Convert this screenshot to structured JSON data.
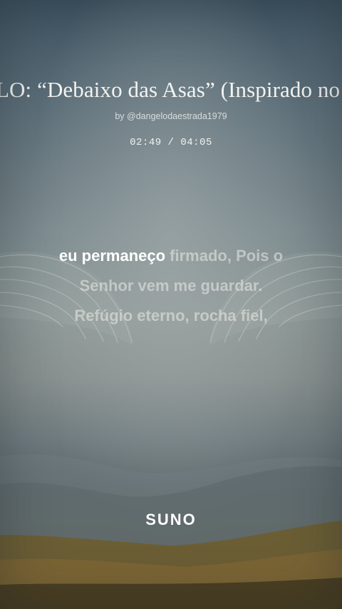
{
  "song": {
    "title": "LO: “Debaixo das Asas” (Inspirado no Sa",
    "byline": "by @dangelodaestrada1979",
    "time": "02:49 / 04:05"
  },
  "lyrics": {
    "line1_sung": "eu permaneço",
    "line1_rest": " firmado, Pois o",
    "line2": "Senhor vem me guardar.",
    "line3": "Refúgio eterno, rocha fiel,"
  },
  "brand": {
    "logo_text": "SUNO"
  },
  "colors": {
    "sung_text": "#ffffff",
    "unsung_text": "#ececE8"
  },
  "icons": [
    "wings-illustration",
    "mountains-illustration"
  ]
}
